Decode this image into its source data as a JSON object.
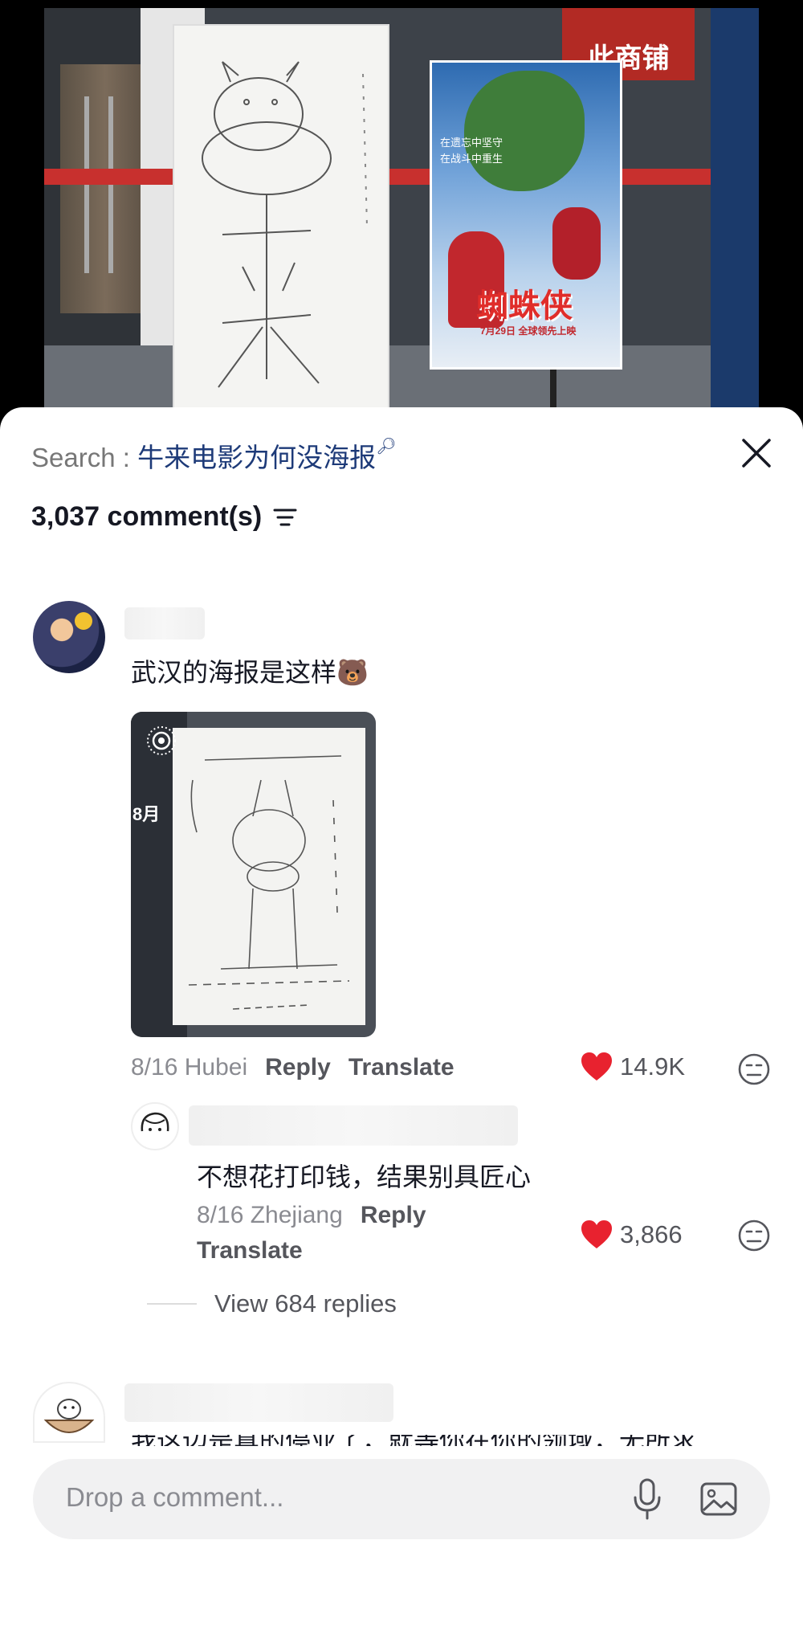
{
  "video": {
    "shop_sign": "此商铺",
    "poster_text_line1": "在遗忘中坚守",
    "poster_text_line2": "在战斗中重生",
    "poster_title": "蜘蛛侠",
    "poster_date": "7月29日 全球领先上映"
  },
  "sheet": {
    "search_label": "Search : ",
    "search_query": "牛来电影为何没海报",
    "comment_count": "3,037 comment(s)"
  },
  "comments": [
    {
      "text": "武汉的海报是这样🐻",
      "meta": "8/16 Hubei",
      "reply": "Reply",
      "translate": "Translate",
      "likes": "14.9K",
      "attachment_label": "8月"
    },
    {
      "text": "不想花打印钱，结果别具匠心",
      "meta": "8/16 Zhejiang",
      "reply": "Reply",
      "translate": "Translate",
      "likes": "3,866"
    }
  ],
  "view_replies": "View 684 replies",
  "third_comment_partial": "我这边是真的停业了，就等你在你的领域，无所求",
  "input": {
    "placeholder": "Drop a comment..."
  },
  "colors": {
    "accent_blue": "#1d3a78",
    "like_red": "#e8222f",
    "sheet_bg": "#ffffff"
  }
}
